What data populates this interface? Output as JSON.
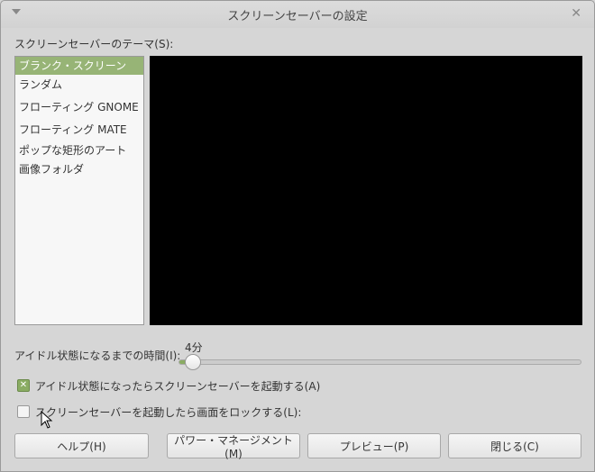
{
  "window": {
    "title": "スクリーンセーバーの設定"
  },
  "theme_label": "スクリーンセーバーのテーマ(S):",
  "themes": [
    "ブランク・スクリーン",
    "ランダム",
    "フローティング GNOME",
    "フローティング MATE",
    "ポップな矩形のアート",
    "画像フォルダ"
  ],
  "selected_theme": "ブランク・スクリーン",
  "idle": {
    "label": "アイドル状態になるまでの時間(I):",
    "value_label": "4分",
    "value_minutes": 4
  },
  "activate_checkbox": {
    "label": "アイドル状態になったらスクリーンセーバーを起動する(A)",
    "checked": true
  },
  "lock_checkbox": {
    "label": "スクリーンセーバーを起動したら画面をロックする(L):",
    "checked": false
  },
  "buttons": {
    "help": "ヘルプ(H)",
    "power": "パワー・マネージメント(M)",
    "preview": "プレビュー(P)",
    "close": "閉じる(C)"
  },
  "colors": {
    "accent": "#97b476",
    "preview_bg": "#000000"
  }
}
